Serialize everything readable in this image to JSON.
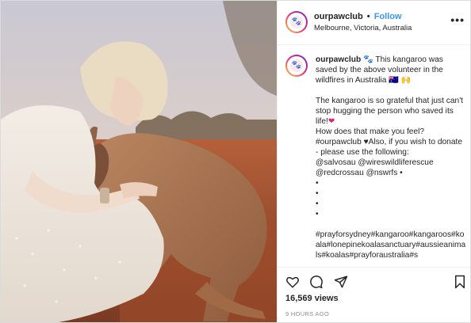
{
  "header": {
    "username": "ourpawclub",
    "separator": "•",
    "follow_label": "Follow",
    "location": "Melbourne, Victoria, Australia",
    "more_label": "•••"
  },
  "caption": {
    "username": "ourpawclub",
    "line1": "🐾 This kangaroo was saved by the above volunteer in the wildfires in Australia 🇦🇺 🙌",
    "line2": "The kangaroo is so grateful that just can't stop hugging the person who saved its life!",
    "heart": "❤",
    "line3": "How does that make you feel?",
    "line4": "#ourpawclub ♥Also, if you wish to donate - please use the following:",
    "line5": "@salvosau @wireswildliferescue @redcrossau @nswrfs •",
    "bullets": [
      "•",
      "•",
      "•",
      "•"
    ],
    "hashtags": "#prayforsydney#kangaroo#kangaroos#koala#lonepinekoalasanctuary#aussieanimals#koalas#prayforaustralia#s"
  },
  "actions": {
    "like_icon": "heart-icon",
    "comment_icon": "comment-icon",
    "share_icon": "share-icon",
    "save_icon": "bookmark-icon"
  },
  "stats": {
    "views": "16,569 views",
    "time": "9 HOURS AGO"
  },
  "colors": {
    "accent": "#3897f0",
    "heart": "#e0245e",
    "border": "#dbdbdb"
  }
}
